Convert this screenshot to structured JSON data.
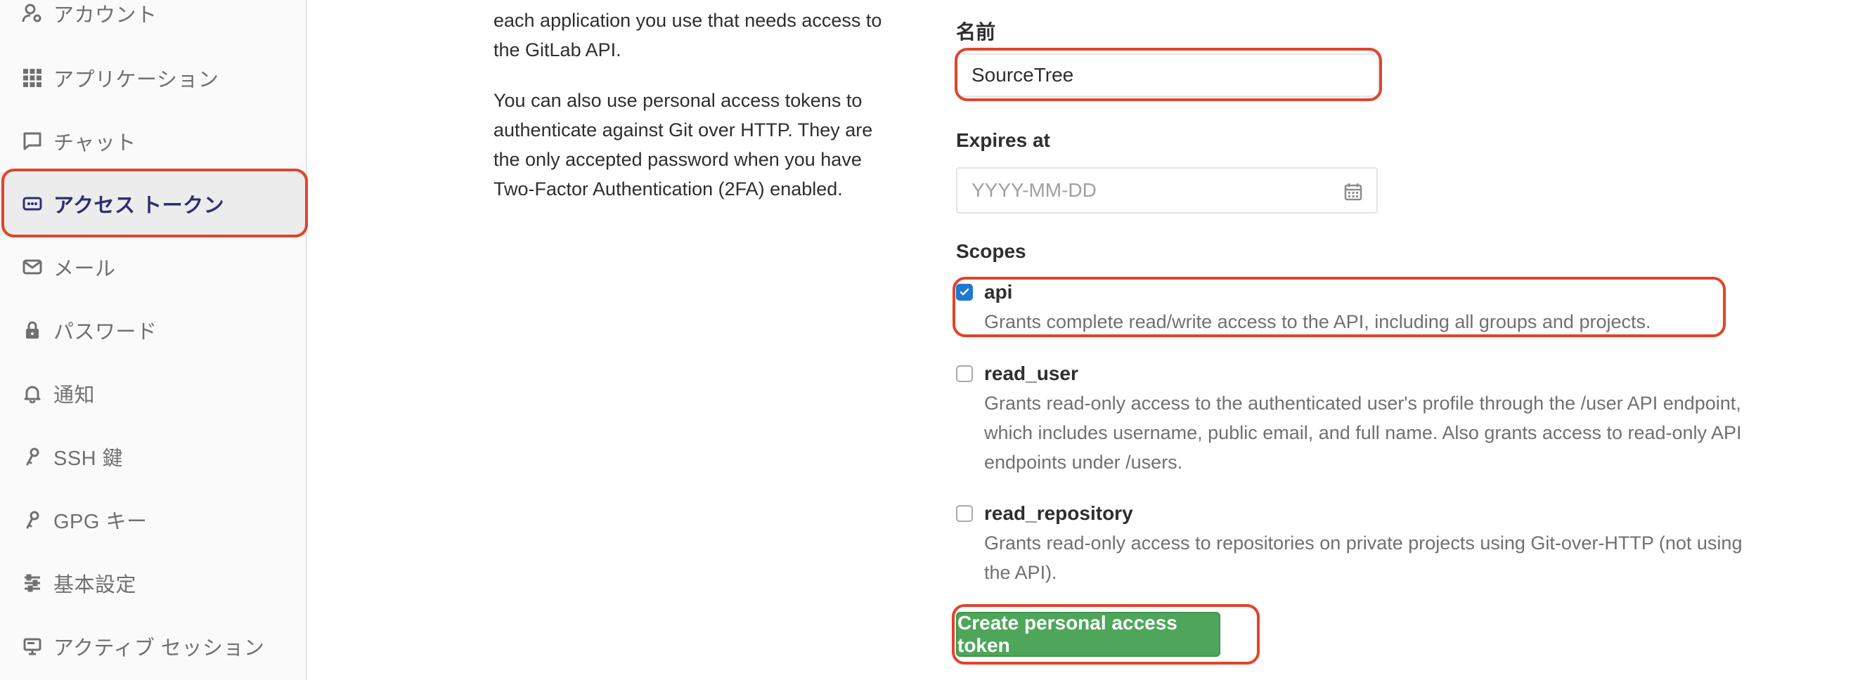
{
  "sidebar": {
    "items": [
      {
        "label": "アカウント",
        "icon": "account-icon"
      },
      {
        "label": "アプリケーション",
        "icon": "applications-grid-icon"
      },
      {
        "label": "チャット",
        "icon": "chat-bubble-icon"
      },
      {
        "label": "アクセス トークン",
        "icon": "access-token-icon",
        "active": true
      },
      {
        "label": "メール",
        "icon": "mail-icon"
      },
      {
        "label": "パスワード",
        "icon": "lock-icon"
      },
      {
        "label": "通知",
        "icon": "bell-icon"
      },
      {
        "label": "SSH 鍵",
        "icon": "key-icon"
      },
      {
        "label": "GPG キー",
        "icon": "key-icon"
      },
      {
        "label": "基本設定",
        "icon": "sliders-icon"
      },
      {
        "label": "アクティブ セッション",
        "icon": "monitor-icon"
      }
    ]
  },
  "description": {
    "paragraph1_lines": [
      "each application you use that needs access to",
      "the GitLab API."
    ],
    "paragraph2_lines": [
      "You can also use personal access tokens to",
      "authenticate against Git over HTTP. They are",
      "the only accepted password when you have",
      "Two-Factor Authentication (2FA) enabled."
    ]
  },
  "form": {
    "name_label": "名前",
    "name_value": "SourceTree",
    "expires_label": "Expires at",
    "expires_placeholder": "YYYY-MM-DD",
    "scopes_label": "Scopes",
    "scopes": [
      {
        "name": "api",
        "checked": true,
        "desc_lines": [
          "Grants complete read/write access to the API, including all groups and projects."
        ]
      },
      {
        "name": "read_user",
        "checked": false,
        "desc_lines": [
          "Grants read-only access to the authenticated user's profile through the /user API endpoint,",
          "which includes username, public email, and full name. Also grants access to read-only API",
          "endpoints under /users."
        ]
      },
      {
        "name": "read_repository",
        "checked": false,
        "desc_lines": [
          "Grants read-only access to repositories on private projects using Git-over-HTTP (not using",
          "the API)."
        ]
      }
    ],
    "submit_label": "Create personal access token"
  },
  "colors": {
    "highlight_box": "#e0442b",
    "active_nav": "#2e2e72",
    "submit_button": "#4ea65a",
    "checkbox_checked": "#1f78d1"
  }
}
